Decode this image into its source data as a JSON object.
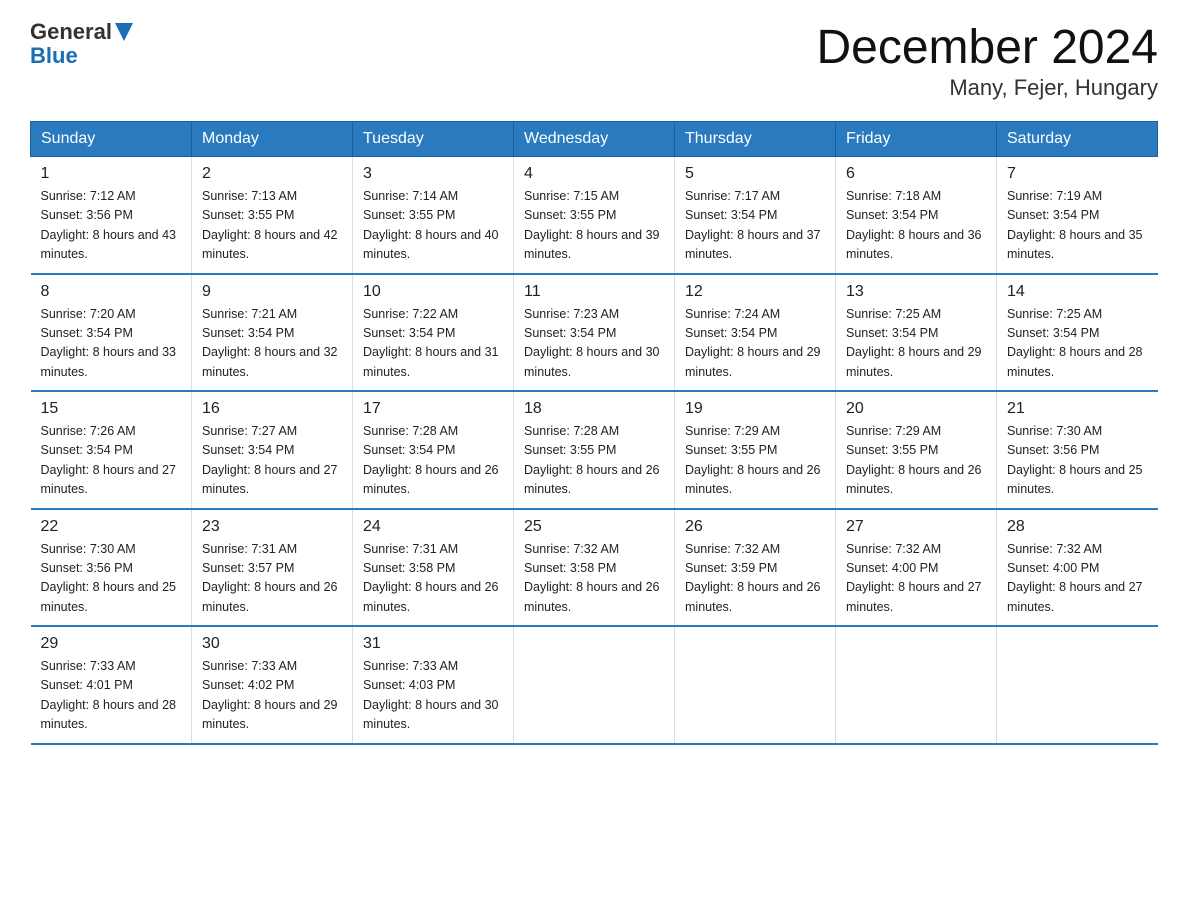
{
  "logo": {
    "text_general": "General",
    "text_blue": "Blue"
  },
  "title": "December 2024",
  "subtitle": "Many, Fejer, Hungary",
  "days_of_week": [
    "Sunday",
    "Monday",
    "Tuesday",
    "Wednesday",
    "Thursday",
    "Friday",
    "Saturday"
  ],
  "weeks": [
    [
      {
        "day": "1",
        "sunrise": "7:12 AM",
        "sunset": "3:56 PM",
        "daylight": "8 hours and 43 minutes."
      },
      {
        "day": "2",
        "sunrise": "7:13 AM",
        "sunset": "3:55 PM",
        "daylight": "8 hours and 42 minutes."
      },
      {
        "day": "3",
        "sunrise": "7:14 AM",
        "sunset": "3:55 PM",
        "daylight": "8 hours and 40 minutes."
      },
      {
        "day": "4",
        "sunrise": "7:15 AM",
        "sunset": "3:55 PM",
        "daylight": "8 hours and 39 minutes."
      },
      {
        "day": "5",
        "sunrise": "7:17 AM",
        "sunset": "3:54 PM",
        "daylight": "8 hours and 37 minutes."
      },
      {
        "day": "6",
        "sunrise": "7:18 AM",
        "sunset": "3:54 PM",
        "daylight": "8 hours and 36 minutes."
      },
      {
        "day": "7",
        "sunrise": "7:19 AM",
        "sunset": "3:54 PM",
        "daylight": "8 hours and 35 minutes."
      }
    ],
    [
      {
        "day": "8",
        "sunrise": "7:20 AM",
        "sunset": "3:54 PM",
        "daylight": "8 hours and 33 minutes."
      },
      {
        "day": "9",
        "sunrise": "7:21 AM",
        "sunset": "3:54 PM",
        "daylight": "8 hours and 32 minutes."
      },
      {
        "day": "10",
        "sunrise": "7:22 AM",
        "sunset": "3:54 PM",
        "daylight": "8 hours and 31 minutes."
      },
      {
        "day": "11",
        "sunrise": "7:23 AM",
        "sunset": "3:54 PM",
        "daylight": "8 hours and 30 minutes."
      },
      {
        "day": "12",
        "sunrise": "7:24 AM",
        "sunset": "3:54 PM",
        "daylight": "8 hours and 29 minutes."
      },
      {
        "day": "13",
        "sunrise": "7:25 AM",
        "sunset": "3:54 PM",
        "daylight": "8 hours and 29 minutes."
      },
      {
        "day": "14",
        "sunrise": "7:25 AM",
        "sunset": "3:54 PM",
        "daylight": "8 hours and 28 minutes."
      }
    ],
    [
      {
        "day": "15",
        "sunrise": "7:26 AM",
        "sunset": "3:54 PM",
        "daylight": "8 hours and 27 minutes."
      },
      {
        "day": "16",
        "sunrise": "7:27 AM",
        "sunset": "3:54 PM",
        "daylight": "8 hours and 27 minutes."
      },
      {
        "day": "17",
        "sunrise": "7:28 AM",
        "sunset": "3:54 PM",
        "daylight": "8 hours and 26 minutes."
      },
      {
        "day": "18",
        "sunrise": "7:28 AM",
        "sunset": "3:55 PM",
        "daylight": "8 hours and 26 minutes."
      },
      {
        "day": "19",
        "sunrise": "7:29 AM",
        "sunset": "3:55 PM",
        "daylight": "8 hours and 26 minutes."
      },
      {
        "day": "20",
        "sunrise": "7:29 AM",
        "sunset": "3:55 PM",
        "daylight": "8 hours and 26 minutes."
      },
      {
        "day": "21",
        "sunrise": "7:30 AM",
        "sunset": "3:56 PM",
        "daylight": "8 hours and 25 minutes."
      }
    ],
    [
      {
        "day": "22",
        "sunrise": "7:30 AM",
        "sunset": "3:56 PM",
        "daylight": "8 hours and 25 minutes."
      },
      {
        "day": "23",
        "sunrise": "7:31 AM",
        "sunset": "3:57 PM",
        "daylight": "8 hours and 26 minutes."
      },
      {
        "day": "24",
        "sunrise": "7:31 AM",
        "sunset": "3:58 PM",
        "daylight": "8 hours and 26 minutes."
      },
      {
        "day": "25",
        "sunrise": "7:32 AM",
        "sunset": "3:58 PM",
        "daylight": "8 hours and 26 minutes."
      },
      {
        "day": "26",
        "sunrise": "7:32 AM",
        "sunset": "3:59 PM",
        "daylight": "8 hours and 26 minutes."
      },
      {
        "day": "27",
        "sunrise": "7:32 AM",
        "sunset": "4:00 PM",
        "daylight": "8 hours and 27 minutes."
      },
      {
        "day": "28",
        "sunrise": "7:32 AM",
        "sunset": "4:00 PM",
        "daylight": "8 hours and 27 minutes."
      }
    ],
    [
      {
        "day": "29",
        "sunrise": "7:33 AM",
        "sunset": "4:01 PM",
        "daylight": "8 hours and 28 minutes."
      },
      {
        "day": "30",
        "sunrise": "7:33 AM",
        "sunset": "4:02 PM",
        "daylight": "8 hours and 29 minutes."
      },
      {
        "day": "31",
        "sunrise": "7:33 AM",
        "sunset": "4:03 PM",
        "daylight": "8 hours and 30 minutes."
      },
      {
        "day": "",
        "sunrise": "",
        "sunset": "",
        "daylight": ""
      },
      {
        "day": "",
        "sunrise": "",
        "sunset": "",
        "daylight": ""
      },
      {
        "day": "",
        "sunrise": "",
        "sunset": "",
        "daylight": ""
      },
      {
        "day": "",
        "sunrise": "",
        "sunset": "",
        "daylight": ""
      }
    ]
  ],
  "labels": {
    "sunrise": "Sunrise: ",
    "sunset": "Sunset: ",
    "daylight": "Daylight: "
  }
}
